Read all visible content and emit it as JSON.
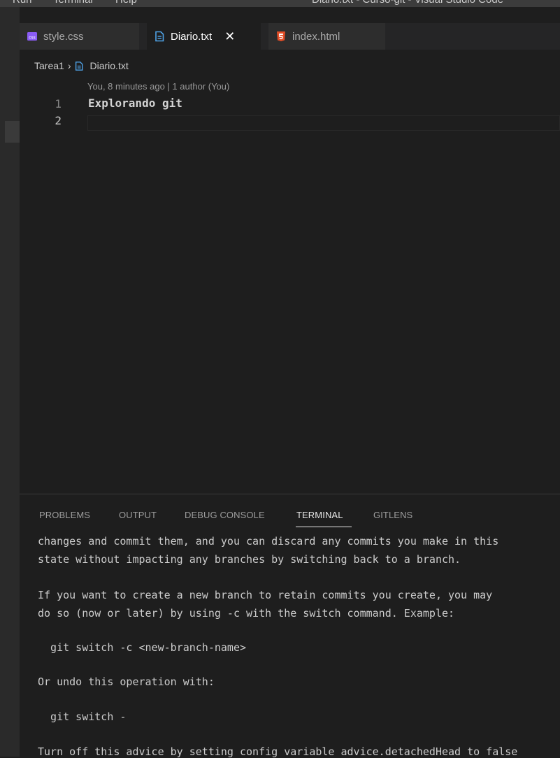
{
  "menubar": {
    "items": [
      "Run",
      "Terminal",
      "Help"
    ],
    "window_title": "Diario.txt - Curso-git - Visual Studio Code"
  },
  "tabs": [
    {
      "label": "style.css",
      "icon": "css-file-icon",
      "active": false
    },
    {
      "label": "Diario.txt",
      "icon": "text-file-icon",
      "active": true,
      "close": "✕"
    },
    {
      "label": "index.html",
      "icon": "html5-file-icon",
      "active": false
    }
  ],
  "breadcrumb": {
    "folder": "Tarea1",
    "separator": "›",
    "file": "Diario.txt"
  },
  "editor": {
    "blame": "You, 8 minutes ago | 1 author (You)",
    "lines": [
      {
        "number": "1",
        "text": "Explorando git"
      },
      {
        "number": "2",
        "text": ""
      }
    ]
  },
  "panel": {
    "tabs": [
      "PROBLEMS",
      "OUTPUT",
      "DEBUG CONSOLE",
      "TERMINAL",
      "GITLENS"
    ],
    "active_tab": "TERMINAL"
  },
  "terminal": {
    "lines": [
      "changes and commit them, and you can discard any commits you make in this",
      "state without impacting any branches by switching back to a branch.",
      "",
      "If you want to create a new branch to retain commits you create, you may",
      "do so (now or later) by using -c with the switch command. Example:",
      "",
      "  git switch -c <new-branch-name>",
      "",
      "Or undo this operation with:",
      "",
      "  git switch -",
      "",
      "Turn off this advice by setting config variable advice.detachedHead to false"
    ]
  },
  "colors": {
    "editor_bg": "#1e1e1e",
    "tab_inactive_bg": "#2d2d2d",
    "css_icon": "#8a5cf5",
    "txt_icon": "#4fa3e8",
    "html_icon": "#e44d26"
  }
}
